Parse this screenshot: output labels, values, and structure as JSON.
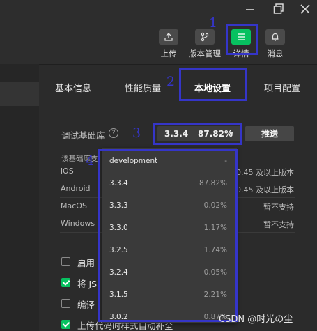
{
  "toolbar": {
    "upload_label": "上传",
    "version_label": "版本管理",
    "details_label": "详情",
    "messages_label": "消息"
  },
  "tabs": [
    {
      "label": "基本信息"
    },
    {
      "label": "性能质量"
    },
    {
      "label": "本地设置"
    },
    {
      "label": "项目配置"
    }
  ],
  "settings": {
    "lib_label": "调试基础库",
    "selected_version": "3.3.4",
    "selected_percent": "87.82%",
    "push_label": "推送",
    "note": "该基础库支",
    "os_rows": [
      {
        "os": "iOS",
        "support": "0.45 及以上版本"
      },
      {
        "os": "Android",
        "support": "0.45 及以上版本"
      },
      {
        "os": "MacOS",
        "support": "暂不支持"
      },
      {
        "os": "Windows",
        "support": "暂不支持"
      }
    ],
    "checkboxes": [
      {
        "label": "启用",
        "checked": false
      },
      {
        "label": "将 JS",
        "checked": true
      },
      {
        "label": "编译",
        "checked": false
      },
      {
        "label": "上传代码时样式自动补全",
        "checked": true
      }
    ]
  },
  "dropdown": {
    "items": [
      {
        "name": "development",
        "pct": "-"
      },
      {
        "name": "3.3.4",
        "pct": "87.82%"
      },
      {
        "name": "3.3.3",
        "pct": "0.02%"
      },
      {
        "name": "3.3.0",
        "pct": "1.17%"
      },
      {
        "name": "3.2.5",
        "pct": "1.74%"
      },
      {
        "name": "3.2.4",
        "pct": "0.05%"
      },
      {
        "name": "3.1.5",
        "pct": "2.21%"
      },
      {
        "name": "3.0.2",
        "pct": "0.87%"
      }
    ]
  },
  "annotations": {
    "n1": "1",
    "n2": "2",
    "n3": "3",
    "n4": "4"
  },
  "watermark": "CSDN @时光の尘",
  "colors": {
    "accent": "#07c160",
    "annotation": "#3535c8",
    "background": "#2b2b2b"
  }
}
